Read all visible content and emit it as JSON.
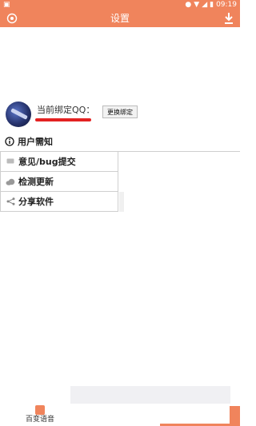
{
  "status_bar": {
    "time": "09:19"
  },
  "header": {
    "title": "设置"
  },
  "account": {
    "label": "当前绑定QQ：",
    "change_button": "更换绑定QQ"
  },
  "menu": [
    {
      "label": "用户需知",
      "icon": "info-icon"
    },
    {
      "label": "意见/bug提交",
      "icon": "message-icon"
    },
    {
      "label": "检测更新",
      "icon": "cloud-icon"
    },
    {
      "label": "分享软件",
      "icon": "share-icon"
    }
  ],
  "bottom_nav": {
    "label": "百变语音"
  },
  "colors": {
    "accent": "#f0845c",
    "redaction": "#e32222"
  }
}
